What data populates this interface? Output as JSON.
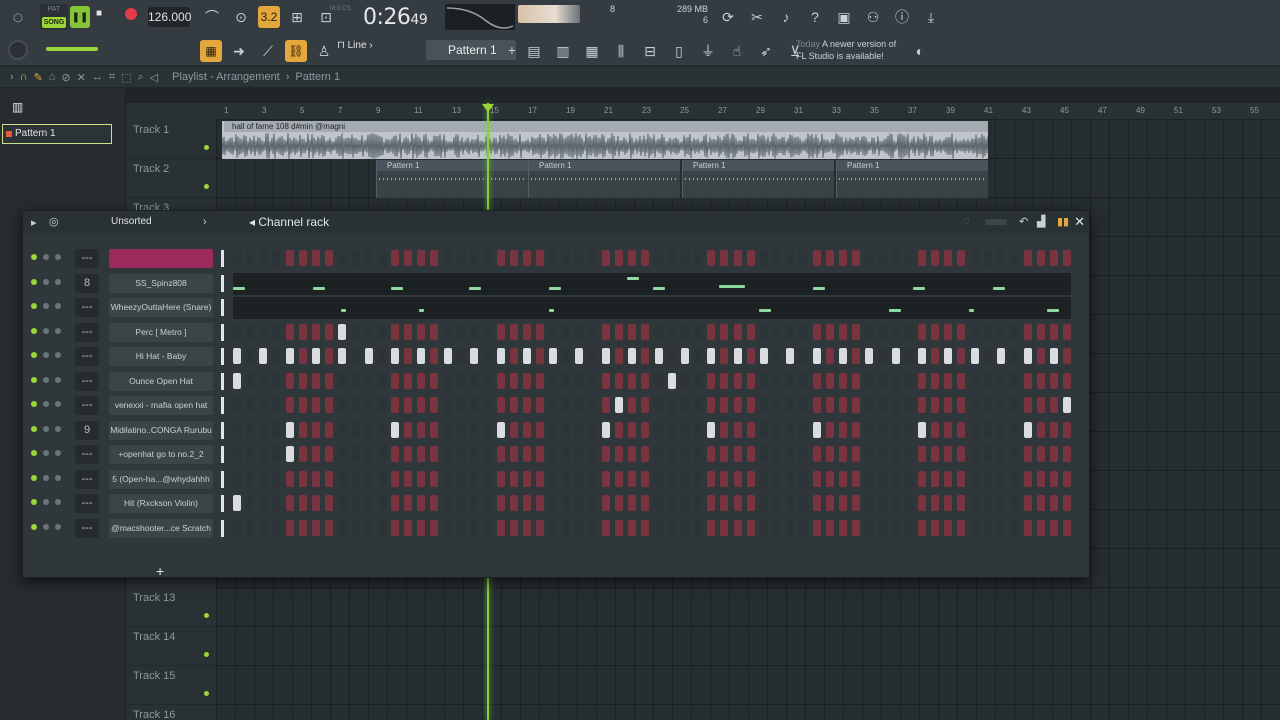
{
  "toolbar": {
    "pat_label": "PAT",
    "song_label": "SONG",
    "tempo": "126.000",
    "pattern_length": "3.2",
    "time_sig_label": "M:S:CS",
    "time_main": "0:26",
    "time_sub": "49",
    "cpu_value": "8",
    "memory_value": "289 MB",
    "polyphony_value": "6",
    "snap_label": "Line",
    "pattern_name": "Pattern 1",
    "hint_today": "Today",
    "hint_text_1": "A newer version of",
    "hint_text_2": "FL Studio is available!"
  },
  "breadcrumb": {
    "path": "Playlist - Arrangement",
    "pattern": "Pattern 1"
  },
  "browser": {
    "items": [
      {
        "label": "Pattern 1"
      }
    ]
  },
  "playlist": {
    "tracks": [
      "Track 1",
      "Track 2",
      "Track 3"
    ],
    "tracks_bottom": [
      "Track 13",
      "Track 14",
      "Track 15",
      "Track 16"
    ],
    "audio_clip_label": "hall of fame 108 d#min @magni",
    "pattern_clip_label": "Pattern 1",
    "ticks": [
      "1",
      "3",
      "5",
      "7",
      "9",
      "11",
      "13",
      "15",
      "17",
      "19",
      "21",
      "23",
      "25",
      "27",
      "29",
      "31",
      "33",
      "35",
      "37",
      "39",
      "41",
      "43",
      "45",
      "47",
      "49",
      "51",
      "53",
      "55"
    ]
  },
  "channel_rack": {
    "title": "Channel rack",
    "filter": "Unsorted",
    "channels": [
      {
        "name": "",
        "num": "---",
        "type": "steps",
        "selected": true
      },
      {
        "name": "SS_Spinz808",
        "num": "8",
        "type": "piano"
      },
      {
        "name": "WheezyOuttaHere (Snare)",
        "num": "---",
        "type": "piano"
      },
      {
        "name": "Perc [ Metro ]",
        "num": "---",
        "type": "steps"
      },
      {
        "name": "Hi Hat - Baby",
        "num": "---",
        "type": "steps"
      },
      {
        "name": "Ounce Open Hat",
        "num": "---",
        "type": "steps"
      },
      {
        "name": "venexxi - mafia open hat",
        "num": "---",
        "type": "steps"
      },
      {
        "name": "Midilatino..CONGA Rurubu",
        "num": "9",
        "type": "steps"
      },
      {
        "name": "+openhat go to no.2_2",
        "num": "---",
        "type": "steps"
      },
      {
        "name": "5 (Open-ha...@whydahhh",
        "num": "---",
        "type": "steps"
      },
      {
        "name": "Hit (Rxckson Violin)",
        "num": "---",
        "type": "steps"
      },
      {
        "name": "@macshooter...ce Scratch",
        "num": "---",
        "type": "steps"
      }
    ],
    "add_label": "+"
  }
}
